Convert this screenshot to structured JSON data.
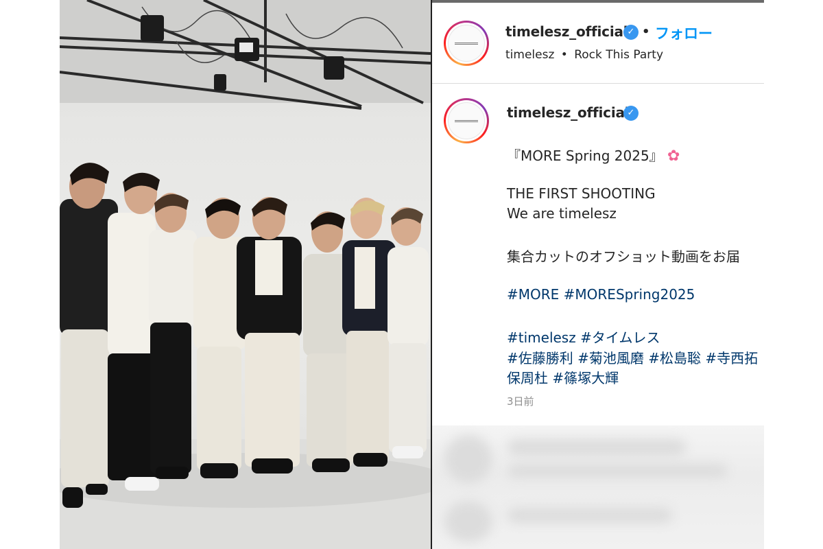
{
  "post": {
    "header": {
      "username": "timelesz_official",
      "verified_mark": "✓",
      "separator": "•",
      "follow_label": "フォロー",
      "artist": "timelesz",
      "audio_separator": "•",
      "audio_title": "Rock This Party"
    },
    "caption": {
      "username": "timelesz_official",
      "verified_mark": "✓",
      "line1": "『MORE Spring 2025』",
      "line1_emoji": "✿",
      "line2": "THE FIRST SHOOTING",
      "line3": "We are timelesz",
      "line4": "集合カットのオフショット動画をお届",
      "tags_row1": [
        "#MORE",
        "#MORESpring2025"
      ],
      "tags_row2": [
        "#timelesz",
        "#タイムレス"
      ],
      "tags_row3": [
        "#佐藤勝利",
        "#菊池風磨",
        "#松島聡",
        "#寺西拓"
      ],
      "tags_row4": [
        "保周杜",
        "#篠塚大輝"
      ],
      "timestamp": "3日前"
    },
    "photo": {
      "description_icon": "group-photo-image",
      "member_count": 8
    }
  },
  "colors": {
    "link": "#0095f6",
    "hashtag": "#00376b",
    "verified": "#3897f0",
    "text": "#262626",
    "muted": "#8e8e8e"
  }
}
